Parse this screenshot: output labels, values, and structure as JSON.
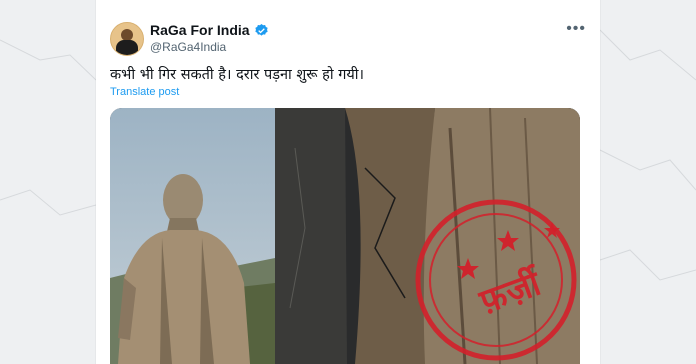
{
  "tweet": {
    "display_name": "RaGa For India",
    "handle": "@RaGa4India",
    "text": "कभी भी गिर सकती है। दरार पड़ना शुरू हो गयी।",
    "translate_label": "Translate post",
    "more_icon": "more-options-icon",
    "verified_icon": "verified-badge-icon",
    "verified_color": "#1d9bf0"
  },
  "stamp": {
    "text": "फ़र्ज़ी",
    "color": "#d3202a"
  }
}
